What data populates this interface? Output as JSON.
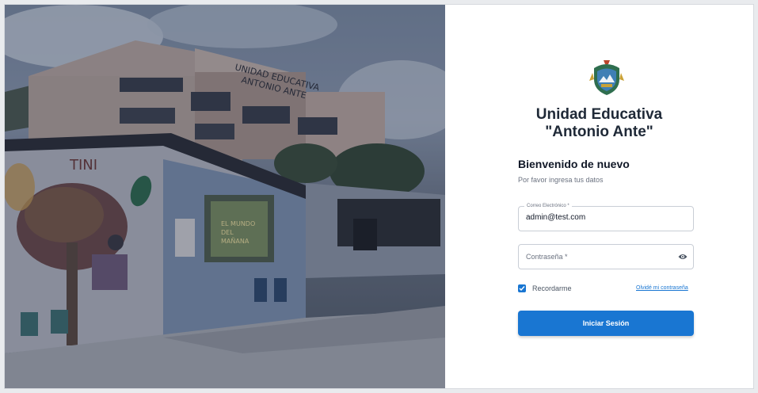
{
  "brand": {
    "title_line1": "Unidad Educativa",
    "title_line2": "\"Antonio Ante\""
  },
  "photo": {
    "building_sign": "UNIDAD EDUCATIVA ANTONIO ANTE",
    "mural_text": "TINI",
    "poster_text": "EL MUNDO DEL MAÑANA"
  },
  "login": {
    "heading": "Bienvenido de nuevo",
    "subtitle": "Por favor ingresa tus datos",
    "email_label": "Correo Electrónico *",
    "email_value": "admin@test.com",
    "password_placeholder": "Contraseña *",
    "remember_label": "Recordarme",
    "remember_checked": true,
    "forgot_link": "Olvidé mi contraseña",
    "submit_label": "Iniciar Sesión"
  },
  "colors": {
    "primary": "#1976d2",
    "heading": "#1f2937",
    "muted": "#6b7280"
  },
  "icons": {
    "password_toggle": "eye-icon",
    "crest": "school-crest-icon",
    "checkbox": "check-icon"
  }
}
